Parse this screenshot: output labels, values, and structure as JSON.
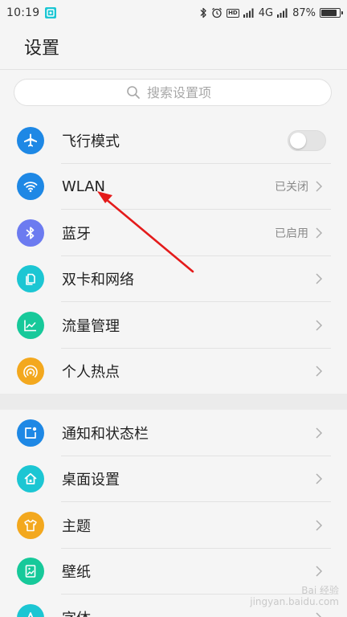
{
  "status_bar": {
    "time": "10:19",
    "network": "4G",
    "battery": "87%",
    "battery_level": 0.87,
    "hd_label": "HD"
  },
  "header": {
    "title": "设置"
  },
  "search": {
    "placeholder": "搜索设置项"
  },
  "colors": {
    "airplane": "#1e88e5",
    "wlan": "#1e88e5",
    "bluetooth": "#6c7bf0",
    "dual_sim": "#1cc6d3",
    "data_usage": "#17c99a",
    "hotspot": "#f3a81e",
    "notification": "#1e88e5",
    "desktop": "#1cc6d3",
    "theme": "#f3a81e",
    "wallpaper": "#17c99a",
    "font": "#1cc6d3",
    "annotation": "#e41b1b"
  },
  "group1": {
    "items": [
      {
        "label": "飞行模式",
        "icon": "airplane-icon",
        "toggle": false
      },
      {
        "label": "WLAN",
        "icon": "wifi-icon",
        "status": "已关闭"
      },
      {
        "label": "蓝牙",
        "icon": "bluetooth-icon",
        "status": "已启用"
      },
      {
        "label": "双卡和网络",
        "icon": "sim-card-icon"
      },
      {
        "label": "流量管理",
        "icon": "chart-line-icon"
      },
      {
        "label": "个人热点",
        "icon": "hotspot-icon"
      }
    ]
  },
  "group2": {
    "items": [
      {
        "label": "通知和状态栏",
        "icon": "notification-icon"
      },
      {
        "label": "桌面设置",
        "icon": "home-icon"
      },
      {
        "label": "主题",
        "icon": "shirt-icon"
      },
      {
        "label": "壁纸",
        "icon": "wallpaper-icon"
      },
      {
        "label": "字体",
        "icon": "font-icon"
      }
    ]
  },
  "watermark": {
    "line1": "Bai 经验",
    "line2": "jingyan.baidu.com"
  }
}
